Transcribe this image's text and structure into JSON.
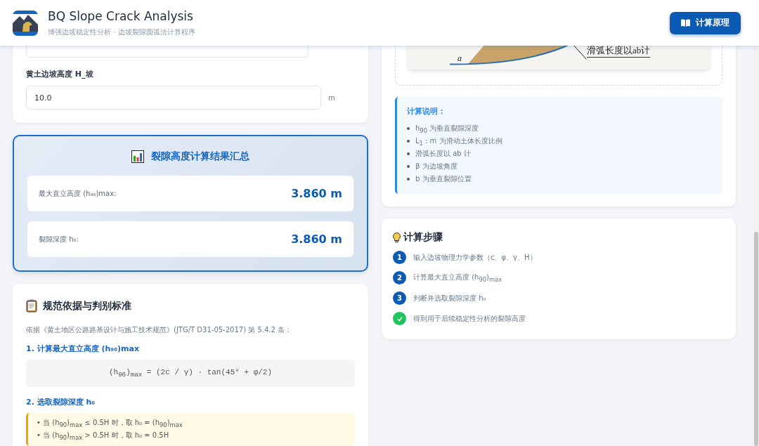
{
  "header": {
    "title": "BQ Slope Crack Analysis",
    "subtitle": "博强边坡稳定性分析 · 边坡裂隙圆弧法计算程序",
    "button": "计算原理"
  },
  "fields": [
    {
      "label": "黄土边坡高度 H_坡",
      "value": "10.0",
      "unit": "m"
    }
  ],
  "results": {
    "title": "裂隙高度计算结果汇总",
    "rows": [
      {
        "label": "最大直立高度 (h₉₀)max:",
        "value": "3.860 m"
      },
      {
        "label": "裂隙深度 h₀:",
        "value": "3.860 m"
      }
    ]
  },
  "norms": {
    "title": "规范依据与判别标准",
    "intro": "依据《黄土地区公路路基设计与施工技术规范》(JTG/T D31-05-2017) 第 5.4.2 条：",
    "sections": [
      {
        "kind": "formula",
        "heading": "1. 计算最大直立高度 (h₉₀)max",
        "formula": "(h$_{90}$)$_{max}$ = (2c / γ) · tan(45° + φ/2)"
      },
      {
        "kind": "rules",
        "heading": "2. 选取裂隙深度 h₀",
        "rules": [
          "• 当 (h$_{90}$)$_{max}$ ≤ 0.5H 时，取 h₀ = (h$_{90}$)$_{max}$",
          "• 当 (h$_{90}$)$_{max}$ > 0.5H 时，取 h₀ = 0.5H"
        ]
      }
    ]
  },
  "diagram": {
    "point_label": "a",
    "arc_label": "滑弧长度以ab计"
  },
  "notes": {
    "title": "计算说明：",
    "items": [
      "h$_{90}$ 为垂直裂隙深度",
      "L$_{1}$ : m 为滑动土体长度比例",
      "滑弧长度以 ab 计",
      "β 为边坡角度",
      "b 为垂直裂隙位置"
    ]
  },
  "steps": {
    "title": "计算步骤",
    "items": [
      {
        "kind": "number",
        "marker": "1",
        "text": "输入边坡物理力学参数（c、φ、γ、H）"
      },
      {
        "kind": "number",
        "marker": "2",
        "text": "计算最大直立高度 (h$_{90}$)$_{max}$"
      },
      {
        "kind": "number",
        "marker": "3",
        "text": "判断并选取裂隙深度 h₀"
      },
      {
        "kind": "done",
        "text": "得到用于后续稳定性分析的裂隙高度"
      }
    ]
  }
}
